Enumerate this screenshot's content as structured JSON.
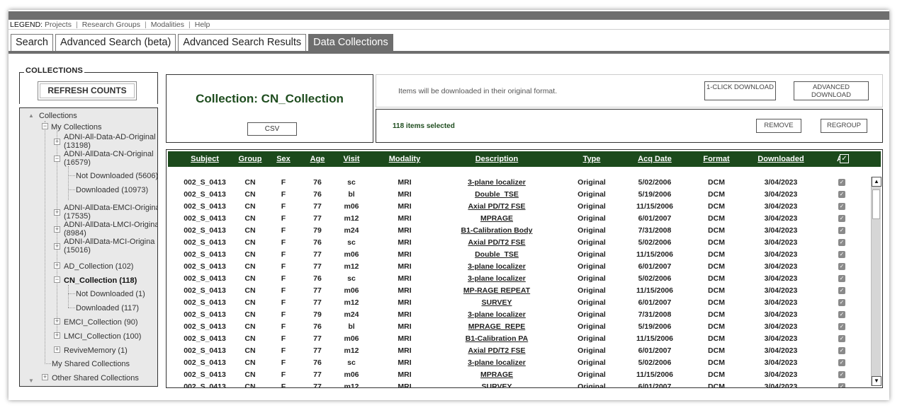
{
  "legend": {
    "label": "LEGEND:",
    "links": [
      "Projects",
      "Research Groups",
      "Modalities",
      "Help"
    ]
  },
  "tabs": [
    "Search",
    "Advanced Search (beta)",
    "Advanced Search Results",
    "Data Collections"
  ],
  "active_tab": "Data Collections",
  "collections_panel": {
    "legend": "COLLECTIONS",
    "refresh_label": "REFRESH COUNTS",
    "tree": {
      "root": "Collections",
      "my_collections": "My Collections",
      "items": [
        {
          "l1": "ADNI-All-Data-AD-Original",
          "l2": "(13198)"
        },
        {
          "l1": "ADNI-AllData-CN-Original",
          "l2": "(16579)"
        },
        {
          "l1": "Not Downloaded (5606)"
        },
        {
          "l1": "Downloaded (10973)"
        },
        {
          "l1": "ADNI-AllData-EMCI-Origina",
          "l2": "(17535)"
        },
        {
          "l1": "ADNI-AllData-LMCI-Origina",
          "l2": "(8984)"
        },
        {
          "l1": "ADNI-AllData-MCI-Origina",
          "l2": "(15016)"
        },
        {
          "l1": "AD_Collection (102)"
        },
        {
          "l1": "CN_Collection (118)"
        },
        {
          "l1": "Not Downloaded (1)"
        },
        {
          "l1": "Downloaded (117)"
        },
        {
          "l1": "EMCI_Collection (90)"
        },
        {
          "l1": "LMCI_Collection (100)"
        },
        {
          "l1": "ReviveMemory (1)"
        }
      ],
      "my_shared": "My Shared Collections",
      "other_shared": "Other Shared Collections"
    }
  },
  "collection": {
    "title": "Collection: CN_Collection",
    "csv_label": "CSV",
    "download_note": "Items will be downloaded in their original format.",
    "one_click_label": "1-CLICK DOWNLOAD",
    "advanced_download_label": "ADVANCED DOWNLOAD",
    "selected_text": "118 items selected",
    "remove_label": "REMOVE",
    "regroup_label": "REGROUP"
  },
  "table": {
    "columns": [
      "Subject",
      "Group",
      "Sex",
      "Age",
      "Visit",
      "Modality",
      "Description",
      "Type",
      "Acq Date",
      "Format",
      "Downloaded",
      "All"
    ],
    "rows": [
      [
        "002_S_0413",
        "CN",
        "F",
        "76",
        "sc",
        "MRI",
        "3-plane localizer",
        "Original",
        "5/02/2006",
        "DCM",
        "3/04/2023"
      ],
      [
        "002_S_0413",
        "CN",
        "F",
        "76",
        "bl",
        "MRI",
        "Double_TSE",
        "Original",
        "5/19/2006",
        "DCM",
        "3/04/2023"
      ],
      [
        "002_S_0413",
        "CN",
        "F",
        "77",
        "m06",
        "MRI",
        "Axial PD/T2 FSE",
        "Original",
        "11/15/2006",
        "DCM",
        "3/04/2023"
      ],
      [
        "002_S_0413",
        "CN",
        "F",
        "77",
        "m12",
        "MRI",
        "MPRAGE",
        "Original",
        "6/01/2007",
        "DCM",
        "3/04/2023"
      ],
      [
        "002_S_0413",
        "CN",
        "F",
        "79",
        "m24",
        "MRI",
        "B1-Calibration Body",
        "Original",
        "7/31/2008",
        "DCM",
        "3/04/2023"
      ],
      [
        "002_S_0413",
        "CN",
        "F",
        "76",
        "sc",
        "MRI",
        "Axial PD/T2 FSE",
        "Original",
        "5/02/2006",
        "DCM",
        "3/04/2023"
      ],
      [
        "002_S_0413",
        "CN",
        "F",
        "77",
        "m06",
        "MRI",
        "Double_TSE",
        "Original",
        "11/15/2006",
        "DCM",
        "3/04/2023"
      ],
      [
        "002_S_0413",
        "CN",
        "F",
        "77",
        "m12",
        "MRI",
        "3-plane localizer",
        "Original",
        "6/01/2007",
        "DCM",
        "3/04/2023"
      ],
      [
        "002_S_0413",
        "CN",
        "F",
        "76",
        "sc",
        "MRI",
        "3-plane localizer",
        "Original",
        "5/02/2006",
        "DCM",
        "3/04/2023"
      ],
      [
        "002_S_0413",
        "CN",
        "F",
        "77",
        "m06",
        "MRI",
        "MP-RAGE REPEAT",
        "Original",
        "11/15/2006",
        "DCM",
        "3/04/2023"
      ],
      [
        "002_S_0413",
        "CN",
        "F",
        "77",
        "m12",
        "MRI",
        "SURVEY",
        "Original",
        "6/01/2007",
        "DCM",
        "3/04/2023"
      ],
      [
        "002_S_0413",
        "CN",
        "F",
        "79",
        "m24",
        "MRI",
        "3-plane localizer",
        "Original",
        "7/31/2008",
        "DCM",
        "3/04/2023"
      ],
      [
        "002_S_0413",
        "CN",
        "F",
        "76",
        "bl",
        "MRI",
        "MPRAGE_REPE",
        "Original",
        "5/19/2006",
        "DCM",
        "3/04/2023"
      ],
      [
        "002_S_0413",
        "CN",
        "F",
        "77",
        "m06",
        "MRI",
        "B1-Calibration PA",
        "Original",
        "11/15/2006",
        "DCM",
        "3/04/2023"
      ],
      [
        "002_S_0413",
        "CN",
        "F",
        "77",
        "m12",
        "MRI",
        "Axial PD/T2 FSE",
        "Original",
        "6/01/2007",
        "DCM",
        "3/04/2023"
      ],
      [
        "002_S_0413",
        "CN",
        "F",
        "76",
        "sc",
        "MRI",
        "3-plane localizer",
        "Original",
        "5/02/2006",
        "DCM",
        "3/04/2023"
      ],
      [
        "002_S_0413",
        "CN",
        "F",
        "77",
        "m06",
        "MRI",
        "MPRAGE",
        "Original",
        "11/15/2006",
        "DCM",
        "3/04/2023"
      ],
      [
        "002_S_0413",
        "CN",
        "F",
        "77",
        "m12",
        "MRI",
        "SURVEY",
        "Original",
        "6/01/2007",
        "DCM",
        "3/04/2023"
      ]
    ]
  },
  "colors": {
    "header_green": "#1c4a1c",
    "title_green": "#1f4d1f",
    "chrome_gray": "#6e6e6e",
    "tree_bg": "#e9e9e9"
  }
}
